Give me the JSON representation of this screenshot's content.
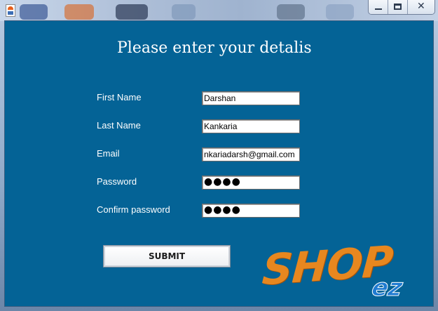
{
  "window": {
    "controls": [
      "minimize-icon",
      "maximize-icon",
      "close-icon"
    ]
  },
  "form": {
    "heading": "Please enter your detalis",
    "fields": {
      "first_name": {
        "label": "First Name",
        "value": "Darshan"
      },
      "last_name": {
        "label": "Last Name",
        "value": "Kankaria"
      },
      "email": {
        "label": "Email",
        "value": "nkariadarsh@gmail.com"
      },
      "password": {
        "label": "Password",
        "value": "●●●●"
      },
      "confirm_password": {
        "label": "Confirm password",
        "value": "●●●●"
      }
    },
    "submit_label": "SUBMIT"
  },
  "logo": {
    "main": "SHOP",
    "sub": "ez"
  },
  "colors": {
    "panel_bg": "#046396",
    "logo_orange": "#e7871f",
    "logo_blue": "#1f7bd1"
  }
}
